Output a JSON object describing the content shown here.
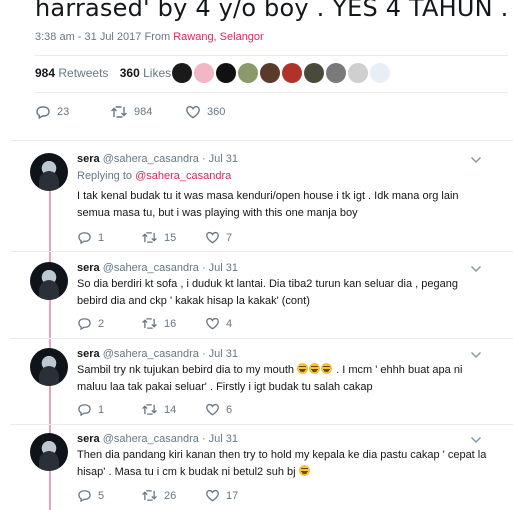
{
  "main_tweet": {
    "headline": "harrased' by 4 y/o boy . YES 4 TAHUN .",
    "time": "3:38 am - 31 Jul 2017",
    "from_label": "From",
    "location": "Rawang, Selangor",
    "retweets_count": "984",
    "retweets_label": "Retweets",
    "likes_count": "360",
    "likes_label": "Likes",
    "liker_avatar_colors": [
      "#1a1a1a",
      "#f3b6c6",
      "#111111",
      "#8a9a6a",
      "#5a3a2a",
      "#b0322a",
      "#4a4a3a",
      "#7a7a7a",
      "#cfcfcf",
      "#e8eef5"
    ],
    "actions": {
      "replies": "23",
      "retweets": "984",
      "likes": "360"
    }
  },
  "replies": [
    {
      "name": "sera",
      "handle": "@sahera_casandra",
      "sep": "·",
      "date": "Jul 31",
      "replying_label": "Replying to",
      "replying_to": "@sahera_casandra",
      "text": "I tak kenal budak tu it was masa kenduri/open house i tk igt . Idk mana org lain semua masa tu, but i was playing with this one manja boy",
      "replies": "1",
      "retweets": "15",
      "likes": "7"
    },
    {
      "name": "sera",
      "handle": "@sahera_casandra",
      "sep": "·",
      "date": "Jul 31",
      "text": "So dia berdiri kt sofa , i duduk kt lantai. Dia tiba2 turun kan seluar dia , pegang bebird dia and ckp ' kakak hisap la kakak' (cont)",
      "replies": "2",
      "retweets": "16",
      "likes": "4"
    },
    {
      "name": "sera",
      "handle": "@sahera_casandra",
      "sep": "·",
      "date": "Jul 31",
      "text_a": "Sambil try nk tujukan bebird dia to my mouth",
      "text_b": ". I mcm ' ehhh buat apa ni maluu laa tak pakai seluar' . Firstly i igt budak tu salah cakap",
      "replies": "1",
      "retweets": "14",
      "likes": "6"
    },
    {
      "name": "sera",
      "handle": "@sahera_casandra",
      "sep": "·",
      "date": "Jul 31",
      "text": "Then dia pandang kiri kanan then try to hold my kepala ke dia pastu cakap ' cepat la hisap' . Masa tu i cm k budak ni betul2 suh bj",
      "replies": "5",
      "retweets": "26",
      "likes": "17"
    }
  ]
}
